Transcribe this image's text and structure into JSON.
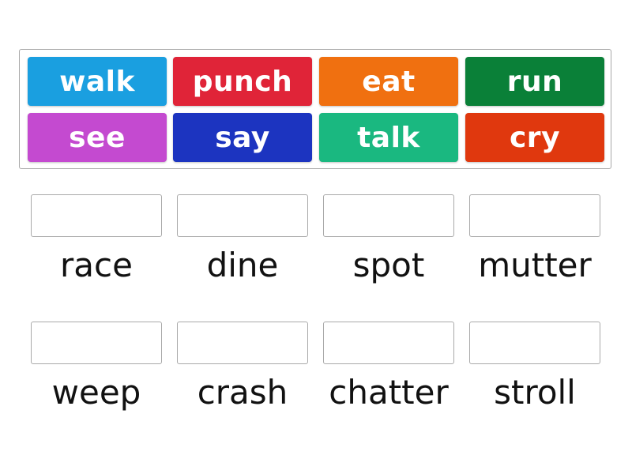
{
  "word_bank": {
    "tiles": [
      {
        "word": "walk",
        "color": "#1a9fe0"
      },
      {
        "word": "punch",
        "color": "#e02438"
      },
      {
        "word": "eat",
        "color": "#f07010"
      },
      {
        "word": "run",
        "color": "#0a8038"
      },
      {
        "word": "see",
        "color": "#c44ad0"
      },
      {
        "word": "say",
        "color": "#1c34c0"
      },
      {
        "word": "talk",
        "color": "#1ab880"
      },
      {
        "word": "cry",
        "color": "#e0380e"
      }
    ]
  },
  "targets": [
    {
      "label": "race"
    },
    {
      "label": "dine"
    },
    {
      "label": "spot"
    },
    {
      "label": "mutter"
    },
    {
      "label": "weep"
    },
    {
      "label": "crash"
    },
    {
      "label": "chatter"
    },
    {
      "label": "stroll"
    }
  ]
}
